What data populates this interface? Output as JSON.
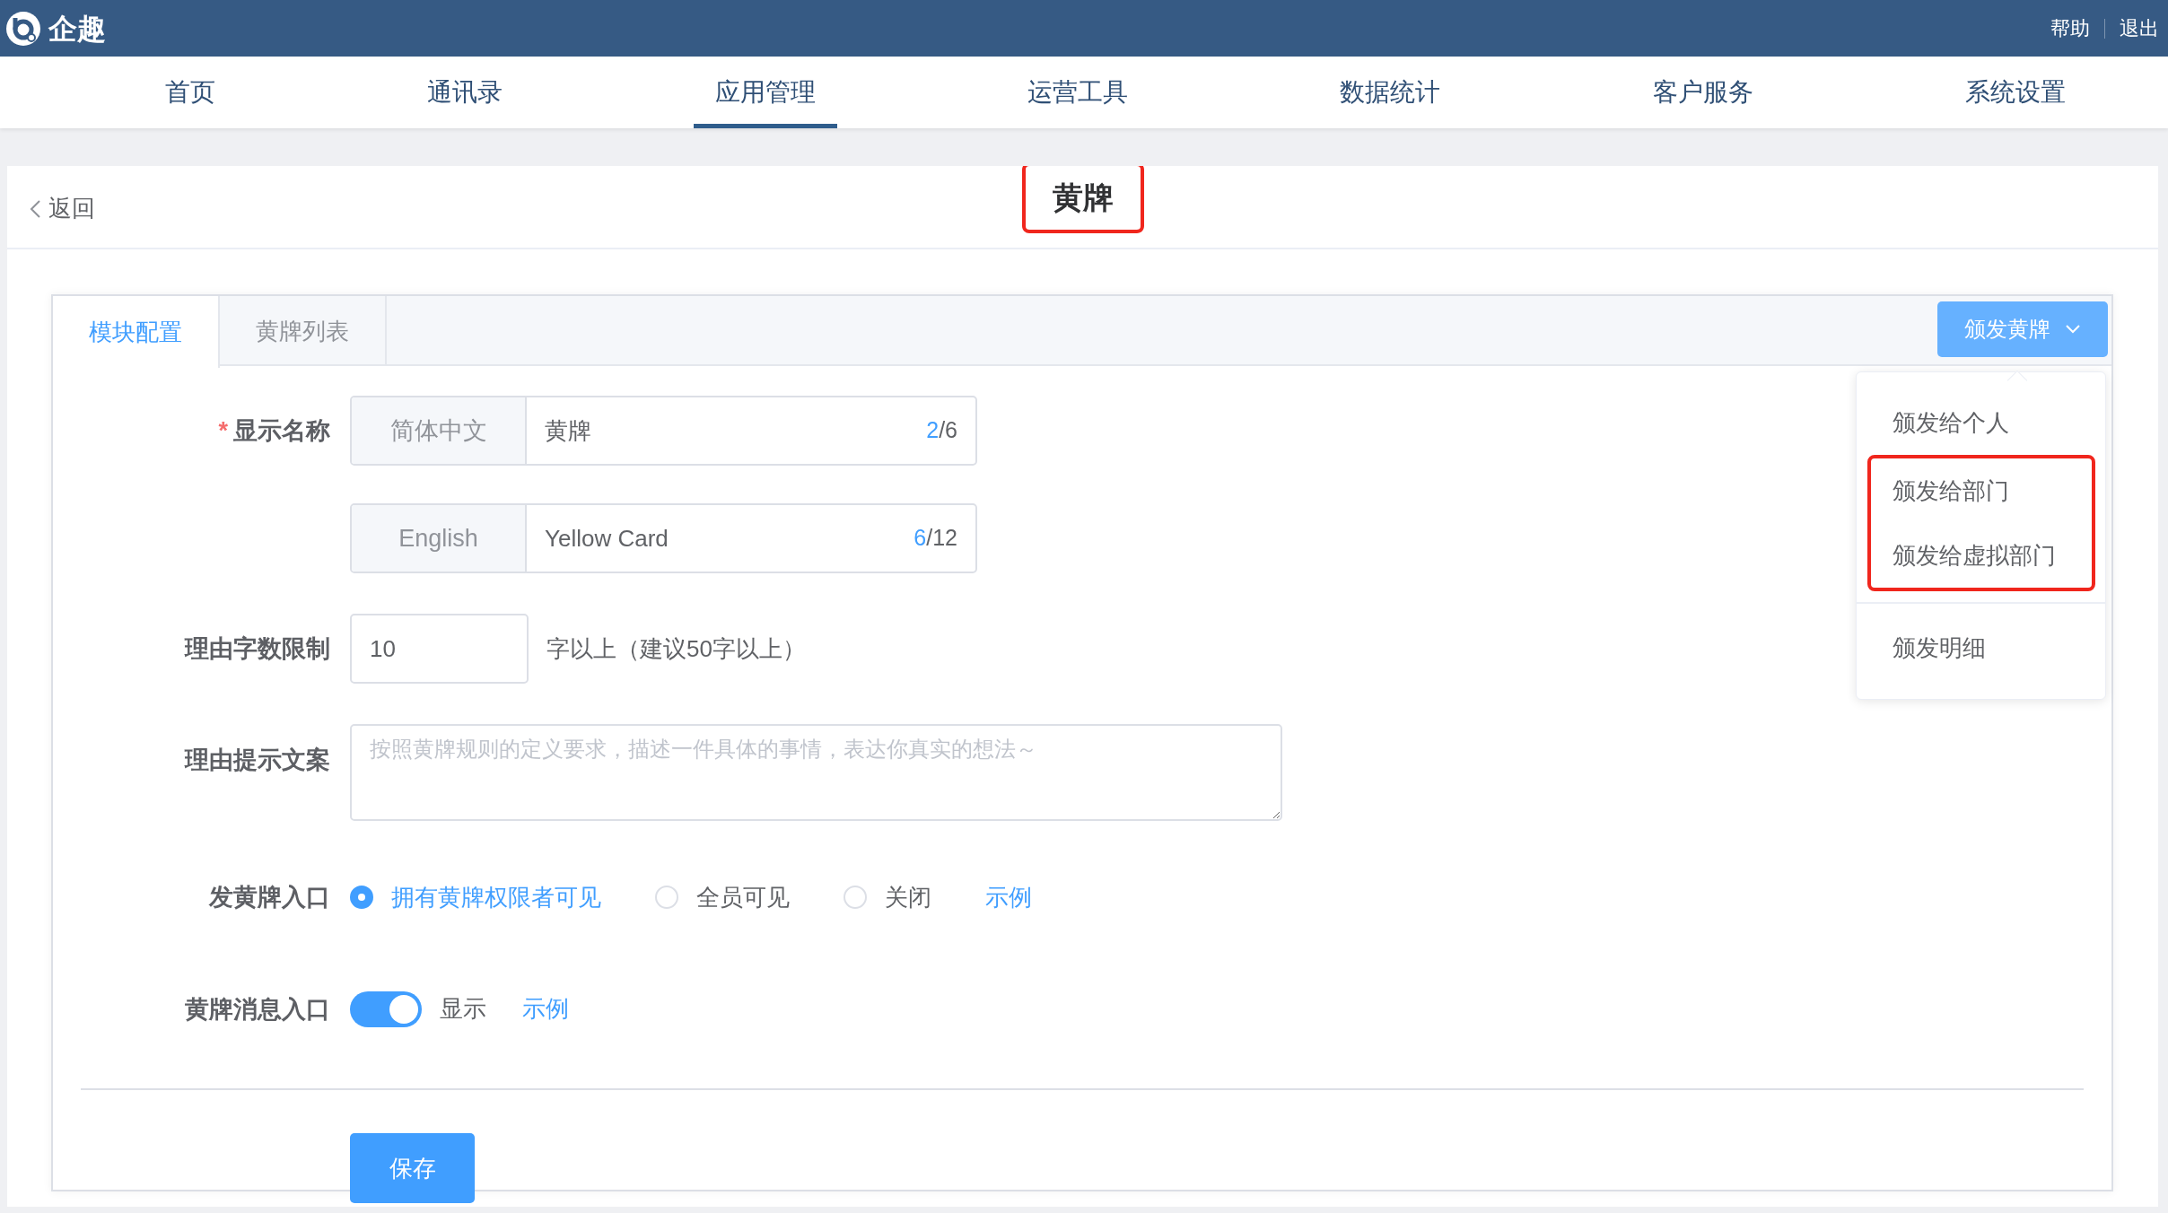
{
  "header": {
    "logo_text": "企趣",
    "links": [
      "帮助",
      "退出"
    ]
  },
  "nav": [
    {
      "label": "首页",
      "selected": false
    },
    {
      "label": "通讯录",
      "selected": false
    },
    {
      "label": "应用管理",
      "selected": true
    },
    {
      "label": "运营工具",
      "selected": false
    },
    {
      "label": "数据统计",
      "selected": false
    },
    {
      "label": "客户服务",
      "selected": false
    },
    {
      "label": "系统设置",
      "selected": false
    }
  ],
  "page": {
    "back": "返回",
    "title": "黄牌",
    "title_highlighted": true
  },
  "tabs": [
    {
      "label": "模块配置",
      "selected": true
    },
    {
      "label": "黄牌列表",
      "selected": false
    }
  ],
  "issue_button": {
    "label": "颁发黄牌",
    "expanded": true
  },
  "menu": [
    {
      "label": "颁发给个人",
      "highlighted": false,
      "separated": false
    },
    {
      "label": "颁发给部门",
      "highlighted": true,
      "separated": false
    },
    {
      "label": "颁发给虚拟部门",
      "highlighted": true,
      "separated": false
    },
    {
      "label": "颁发明细",
      "highlighted": false,
      "separated": true
    }
  ],
  "form": {
    "display_name": {
      "label": "显示名称",
      "required_mark": "*",
      "langs": [
        {
          "lang": "简体中文",
          "value": "黄牌",
          "count": "2",
          "limit": "/6"
        },
        {
          "lang": "English",
          "value": "Yellow Card",
          "count": "6",
          "limit": "/12"
        }
      ]
    },
    "reason_limit": {
      "label": "理由字数限制",
      "value": "10",
      "suffix": "字以上（建议50字以上）"
    },
    "reason_hint": {
      "label": "理由提示文案",
      "placeholder": "按照黄牌规则的定义要求，描述一件具体的事情，表达你真实的想法～"
    },
    "entry": {
      "label": "发黄牌入口",
      "options": [
        {
          "label": "拥有黄牌权限者可见",
          "selected": true
        },
        {
          "label": "全员可见",
          "selected": false
        },
        {
          "label": "关闭",
          "selected": false
        }
      ],
      "example": "示例"
    },
    "message_entry": {
      "label": "黄牌消息入口",
      "on": true,
      "state_text": "显示",
      "example": "示例"
    },
    "save": "保存"
  }
}
